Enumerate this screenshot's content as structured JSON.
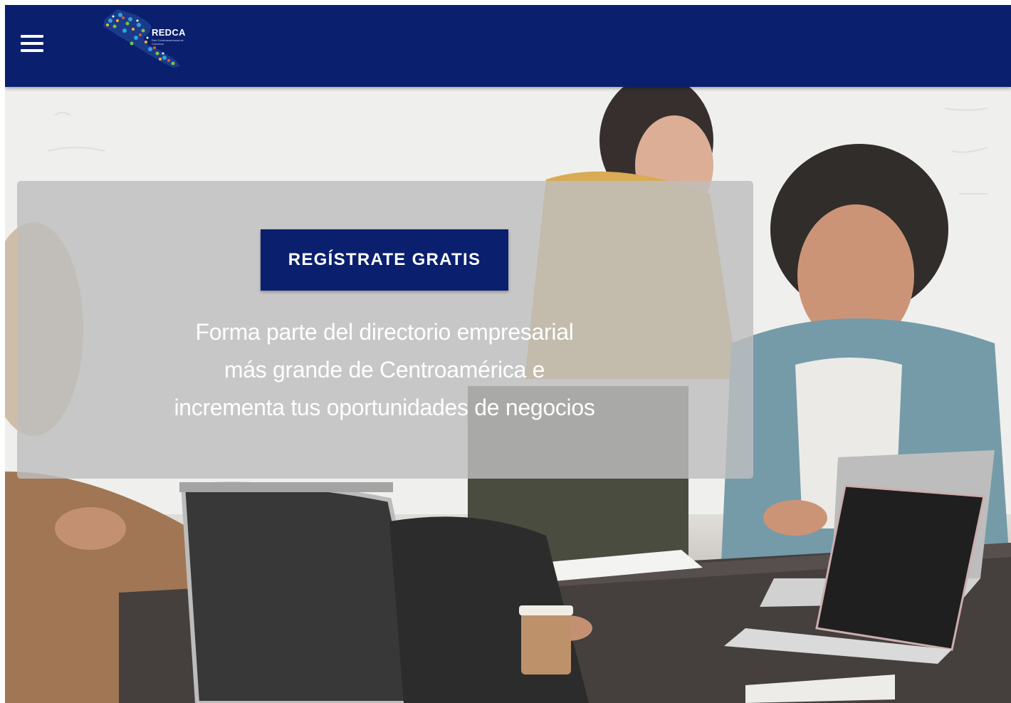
{
  "header": {
    "menu_icon": "hamburger-menu-icon",
    "logo": {
      "name": "REDCA",
      "subtitle": "Red Centroamericana de Comercio",
      "icon": "central-america-map-logo"
    },
    "background_color": "#0a1f6e"
  },
  "hero": {
    "image": "team-meeting-photo",
    "card": {
      "cta_label": "REGÍSTRATE GRATIS",
      "tagline_lines": [
        "Forma parte del directorio empresarial",
        "más grande de Centroamérica e",
        "incrementa tus oportunidades de negocios"
      ]
    }
  },
  "colors": {
    "brand_navy": "#0a1f6e",
    "card_overlay": "rgba(190,190,190,0.82)",
    "text_on_dark": "#ffffff"
  }
}
